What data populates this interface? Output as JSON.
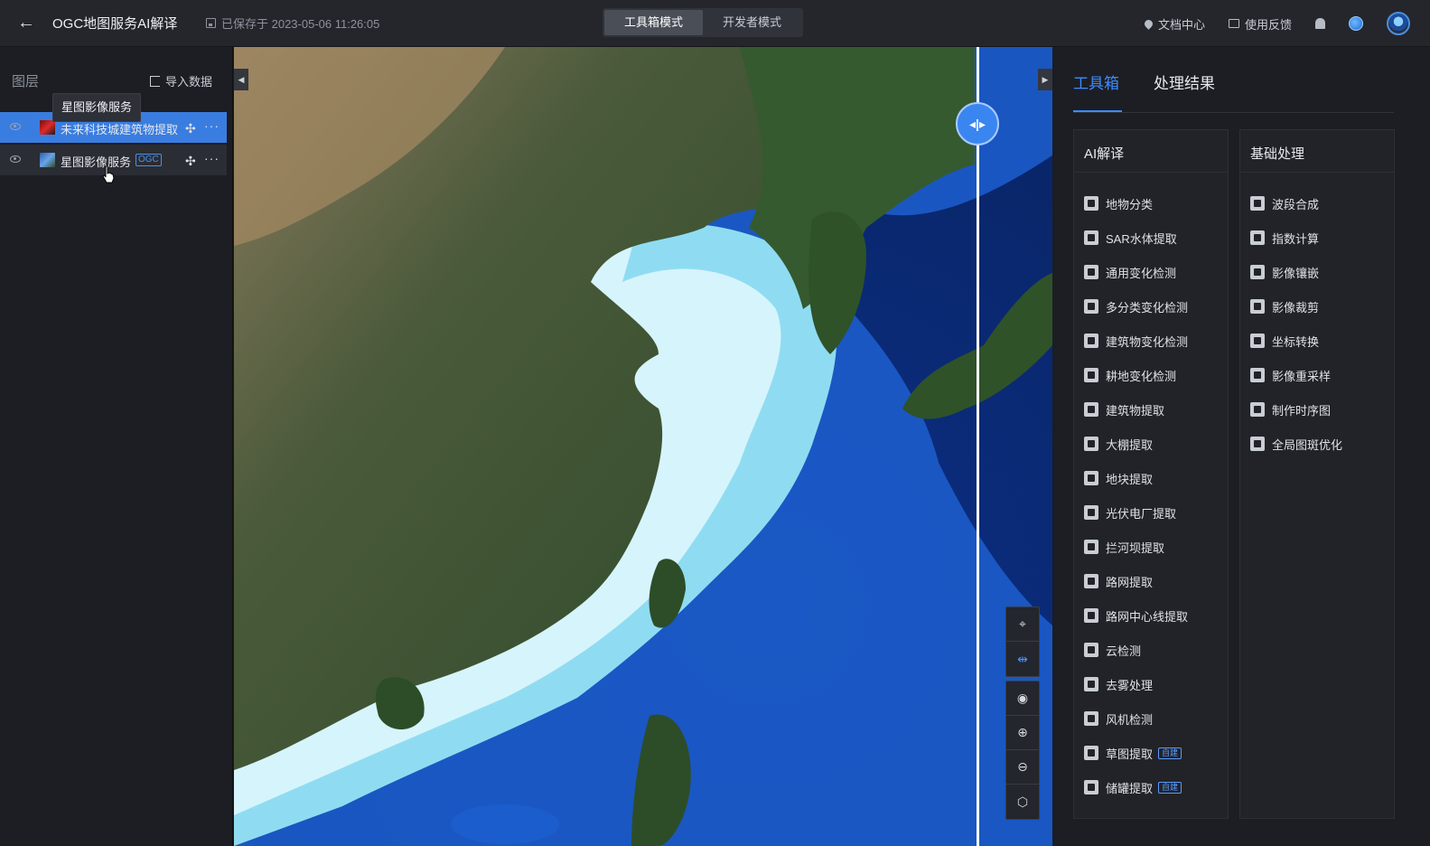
{
  "header": {
    "title": "OGC地图服务AI解译",
    "saved_text": "已保存于 2023-05-06 11:26:05",
    "modes": [
      "工具箱模式",
      "开发者模式"
    ],
    "active_mode": "工具箱模式",
    "links": {
      "docs": "文档中心",
      "feedback": "使用反馈"
    }
  },
  "layers": {
    "heading": "图层",
    "import_label": "导入数据",
    "tooltip": "星图影像服务",
    "items": [
      {
        "name": "未来科技城建筑物提取",
        "tag": ""
      },
      {
        "name": "星图影像服务",
        "tag": "OGC"
      }
    ]
  },
  "map": {
    "collapse_left": "◀",
    "collapse_right": "▶",
    "split_handle": "◂|▸",
    "tools": [
      "select-icon",
      "split-icon",
      "globe-icon",
      "zoom-in-icon",
      "zoom-out-icon",
      "3d-icon"
    ]
  },
  "toolbox": {
    "tabs": [
      "工具箱",
      "处理结果"
    ],
    "active_tab": "工具箱",
    "ai": {
      "title": "AI解译",
      "items": [
        {
          "label": "地物分类"
        },
        {
          "label": "SAR水体提取"
        },
        {
          "label": "通用变化检测"
        },
        {
          "label": "多分类变化检测"
        },
        {
          "label": "建筑物变化检测"
        },
        {
          "label": "耕地变化检测"
        },
        {
          "label": "建筑物提取"
        },
        {
          "label": "大棚提取"
        },
        {
          "label": "地块提取"
        },
        {
          "label": "光伏电厂提取"
        },
        {
          "label": "拦河坝提取"
        },
        {
          "label": "路网提取"
        },
        {
          "label": "路网中心线提取"
        },
        {
          "label": "云检测"
        },
        {
          "label": "去雾处理"
        },
        {
          "label": "风机检测"
        },
        {
          "label": "草图提取",
          "badge": "自建"
        },
        {
          "label": "储罐提取",
          "badge": "自建"
        }
      ]
    },
    "basic": {
      "title": "基础处理",
      "items": [
        {
          "label": "波段合成"
        },
        {
          "label": "指数计算"
        },
        {
          "label": "影像镶嵌"
        },
        {
          "label": "影像裁剪"
        },
        {
          "label": "坐标转换"
        },
        {
          "label": "影像重采样"
        },
        {
          "label": "制作时序图"
        },
        {
          "label": "全局图斑优化"
        }
      ]
    }
  }
}
